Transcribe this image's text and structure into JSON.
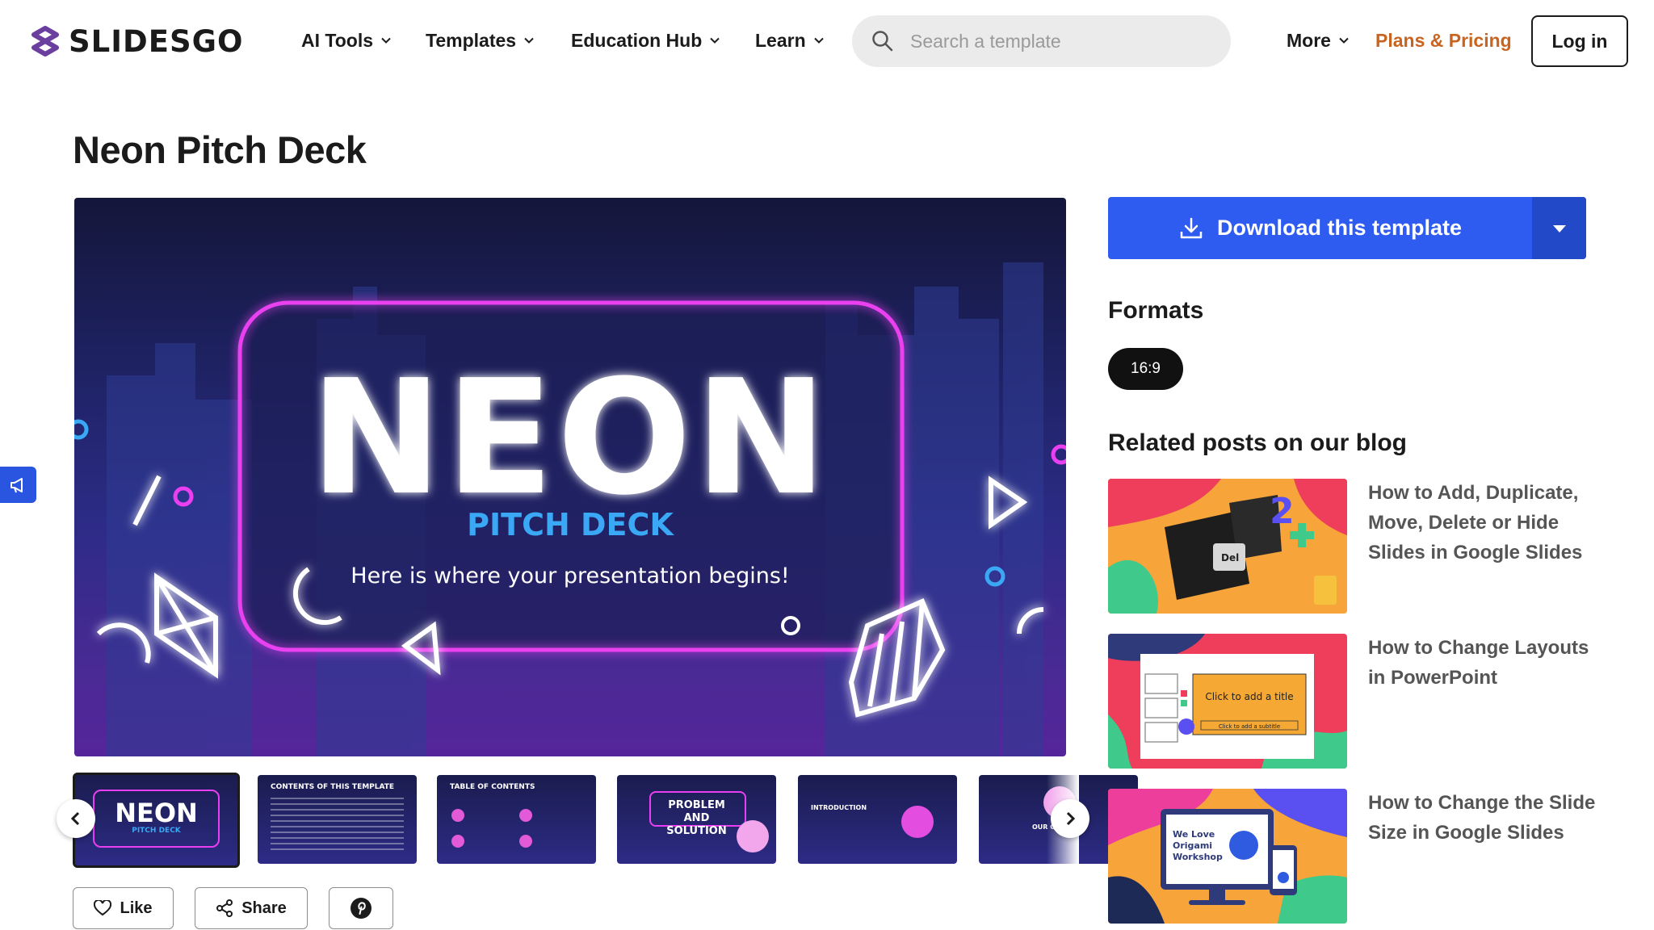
{
  "header": {
    "logo_text": "SLIDESGO",
    "nav": [
      {
        "label": "AI Tools",
        "icon": "chevron-down-icon"
      },
      {
        "label": "Templates",
        "icon": "chevron-down-icon"
      },
      {
        "label": "Education Hub",
        "icon": "chevron-down-icon"
      },
      {
        "label": "Learn",
        "icon": "chevron-down-icon"
      }
    ],
    "search_placeholder": "Search a template",
    "more_label": "More",
    "plans_label": "Plans & Pricing",
    "login_label": "Log in",
    "accent_color": "#c8641f"
  },
  "page": {
    "title": "Neon Pitch Deck"
  },
  "preview": {
    "big_word": "NEON",
    "subtitle": "PITCH DECK",
    "tagline": "Here is where your presentation begins!"
  },
  "thumbnails": [
    {
      "title": "NEON",
      "sub": "PITCH DECK"
    },
    {
      "title": "CONTENTS OF THIS TEMPLATE"
    },
    {
      "title": "TABLE OF CONTENTS"
    },
    {
      "title": "PROBLEM AND SOLUTION"
    },
    {
      "title": "INTRODUCTION"
    },
    {
      "title": "OUR C"
    }
  ],
  "actions": {
    "like_label": "Like",
    "share_label": "Share",
    "pinterest_icon": "pinterest-icon"
  },
  "sidebar": {
    "download_label": "Download this template",
    "download_color": "#2e5bf0",
    "formats_heading": "Formats",
    "format_value": "16:9",
    "related_heading": "Related posts on our blog",
    "posts": [
      {
        "title": "How to Add, Duplicate, Move, Delete or Hide Slides in Google Slides",
        "img_text": "Del"
      },
      {
        "title": "How to Change Layouts in PowerPoint",
        "img_text": "Click to add a title",
        "img_sub": "Click to add a subtitle"
      },
      {
        "title": "How to Change the Slide Size in Google Slides",
        "img_text": "We Love Origami Workshop"
      }
    ]
  }
}
